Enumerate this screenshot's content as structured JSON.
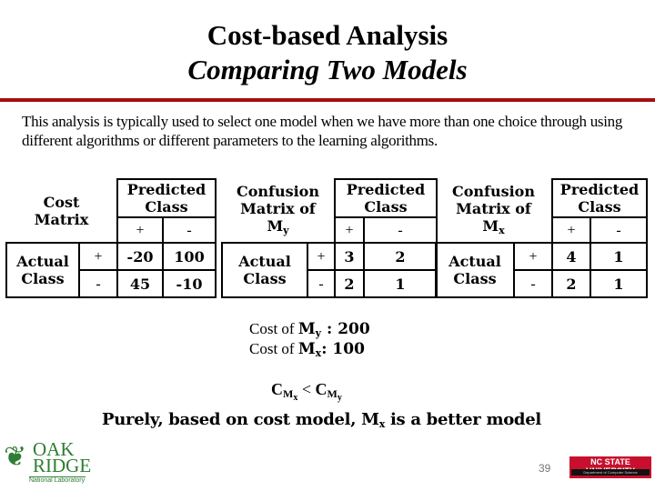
{
  "title": {
    "line1": "Cost-based Analysis",
    "line2": "Comparing Two Models"
  },
  "intro": "This analysis is typically used to select one model when we have more than one choice through using different algorithms or different parameters to the learning algorithms.",
  "cost_matrix": {
    "label_line1": "Cost",
    "label_line2": "Matrix",
    "predicted_line1": "Predicted",
    "predicted_line2": "Class",
    "actual_line1": "Actual",
    "actual_line2": "Class",
    "col_signs": [
      "+",
      "-"
    ],
    "row_signs": [
      "+",
      "-"
    ],
    "values": [
      [
        "-20",
        "100"
      ],
      [
        "45",
        "-10"
      ]
    ]
  },
  "matrix_y": {
    "label_line1": "Confusion",
    "label_line2": "Matrix of",
    "model": "M",
    "model_sub": "y",
    "predicted_line1": "Predicted",
    "predicted_line2": "Class",
    "actual_line1": "Actual",
    "actual_line2": "Class",
    "col_signs": [
      "+",
      "-"
    ],
    "row_signs": [
      "+",
      "-"
    ],
    "values": [
      [
        "3",
        "2"
      ],
      [
        "2",
        "1"
      ]
    ]
  },
  "matrix_x": {
    "label_line1": "Confusion",
    "label_line2": "Matrix of",
    "model": "M",
    "model_sub": "x",
    "predicted_line1": "Predicted",
    "predicted_line2": "Class",
    "actual_line1": "Actual",
    "actual_line2": "Class",
    "col_signs": [
      "+",
      "-"
    ],
    "row_signs": [
      "+",
      "-"
    ],
    "values": [
      [
        "4",
        "1"
      ],
      [
        "2",
        "1"
      ]
    ]
  },
  "costs": {
    "y_prefix": "Cost of ",
    "y_model": "M",
    "y_sub": "y",
    "y_value": " : 200",
    "x_prefix": "Cost of ",
    "x_model": "M",
    "x_sub": "x",
    "x_value": ": 100"
  },
  "comparison": {
    "left": "C",
    "left_sub": "M",
    "left_subsub": "x",
    "op": " < ",
    "right": "C",
    "right_sub": "M",
    "right_subsub": "y"
  },
  "conclusion": {
    "prefix": "Purely, based on cost model, ",
    "model": "M",
    "model_sub": "x",
    "suffix": " is a better model"
  },
  "footer": {
    "page_number": "39",
    "left_logo": {
      "line1": "OAK",
      "line2": "RIDGE",
      "line3": "National Laboratory"
    },
    "right_logo": {
      "line1": "NC STATE UNIVERSITY",
      "line2": "Department of Computer Science"
    }
  },
  "colors": {
    "rule": "#a50e10",
    "ornl_green": "#2e7d32",
    "ncsu_red": "#c8102e"
  }
}
